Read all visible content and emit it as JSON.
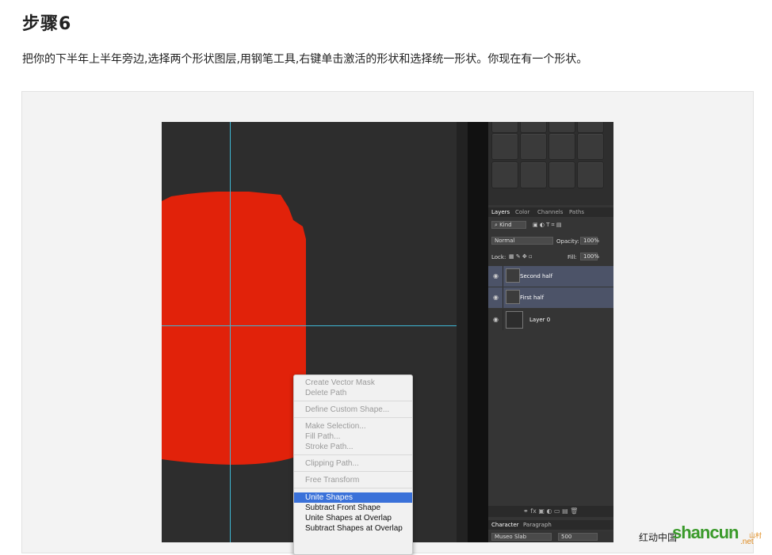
{
  "article": {
    "title": "步骤6",
    "description": "把你的下半年上半年旁边,选择两个形状图层,用钢笔工具,右键单击激活的形状和选择统一形状。你现在有一个形状。"
  },
  "colors": {
    "can_red": "#e1220a",
    "guide": "#3fb8d6",
    "menu_highlight": "#3a71d9",
    "selected_layer": "#4c5368"
  },
  "layers_panel": {
    "tabs": [
      "Layers",
      "Color",
      "Channels",
      "Paths"
    ],
    "filter_kind": "Kind",
    "blend_mode": "Normal",
    "opacity_label": "Opacity:",
    "opacity_value": "100%",
    "lock_label": "Lock:",
    "fill_label": "Fill:",
    "fill_value": "100%",
    "layers": [
      {
        "name": "Second half",
        "selected": true,
        "icon": "shape-layer-icon"
      },
      {
        "name": "First half",
        "selected": true,
        "icon": "shape-layer-icon"
      },
      {
        "name": "Layer 0",
        "selected": false,
        "icon": "layer-thumbnail"
      }
    ]
  },
  "character_panel": {
    "tabs": [
      "Character",
      "Paragraph"
    ],
    "font": "Museo Slab",
    "weight": "500"
  },
  "context_menu": {
    "groups": [
      [
        "Create Vector Mask",
        "Delete Path"
      ],
      [
        "Define Custom Shape..."
      ],
      [
        "Make Selection...",
        "Fill Path...",
        "Stroke Path..."
      ],
      [
        "Clipping Path..."
      ],
      [
        "Free Transform"
      ],
      [
        "Unite Shapes",
        "Subtract Front Shape",
        "Unite Shapes at Overlap",
        "Subtract Shapes at Overlap"
      ]
    ],
    "highlighted": "Unite Shapes",
    "disabled_groups": [
      0,
      1,
      2,
      3,
      4
    ]
  },
  "watermark": {
    "text": "红动中国",
    "logo": "shancun",
    "suffix": ".net",
    "tag": "山村"
  }
}
